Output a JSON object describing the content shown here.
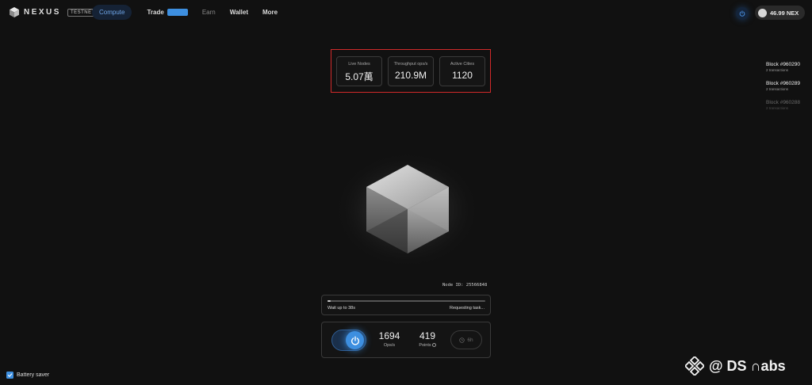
{
  "brand": {
    "name": "NEXUS",
    "badge": "TESTNET"
  },
  "nav": {
    "items": [
      {
        "label": "Compute",
        "state": "active"
      },
      {
        "label": "Trade",
        "state": "normal"
      },
      {
        "label": "Earn",
        "state": "dim"
      },
      {
        "label": "Wallet",
        "state": "normal"
      },
      {
        "label": "More",
        "state": "normal"
      }
    ]
  },
  "header": {
    "balance": "46.99 NEX"
  },
  "stats": [
    {
      "label": "Live Nodes",
      "value": "5.07萬"
    },
    {
      "label": "Throughput ops/s",
      "value": "210.9M"
    },
    {
      "label": "Active Cities",
      "value": "1120"
    }
  ],
  "blocks": [
    {
      "title": "Block #960290",
      "sub": "2 transactions"
    },
    {
      "title": "Block #960289",
      "sub": "2 transactions"
    },
    {
      "title": "Block #960288",
      "sub": "2 transactions"
    }
  ],
  "node": {
    "id_label": "Node ID: 25566848"
  },
  "task": {
    "wait": "Wait up to 38s",
    "status": "Requesting task...",
    "progress": 0.01
  },
  "metrics": [
    {
      "value": "1694",
      "label": "Ops/s"
    },
    {
      "value": "419",
      "label": "Points"
    }
  ],
  "timer": {
    "label": "6h"
  },
  "footer": {
    "battery_saver": "Battery saver"
  },
  "watermark": {
    "text": "@ DS ∩abs"
  },
  "colors": {
    "accent": "#3d8fe0",
    "highlight_border": "#d12a2a",
    "background": "#111111"
  }
}
